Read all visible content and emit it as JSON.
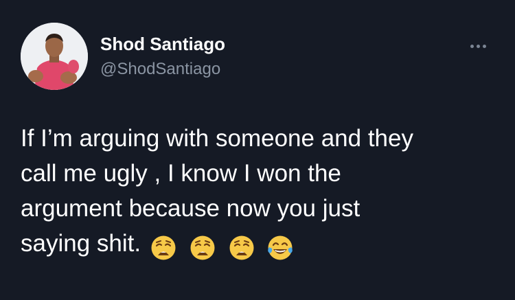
{
  "tweet": {
    "author": {
      "display_name": "Shod Santiago",
      "handle": "@ShodSantiago",
      "avatar_icon": "profile-photo"
    },
    "more_icon": "more-horizontal-icon",
    "text_lines": [
      "If I’m arguing with someone and they",
      "call me ugly , I know I won the",
      "argument because now you just",
      "saying shit."
    ],
    "emojis": [
      "weary-face",
      "weary-face",
      "weary-face",
      "face-with-tears-of-joy"
    ]
  },
  "colors": {
    "background": "#151a25",
    "primary_text": "#ffffff",
    "secondary_text": "#8b95a3",
    "emoji_yellow": "#f7c948"
  }
}
